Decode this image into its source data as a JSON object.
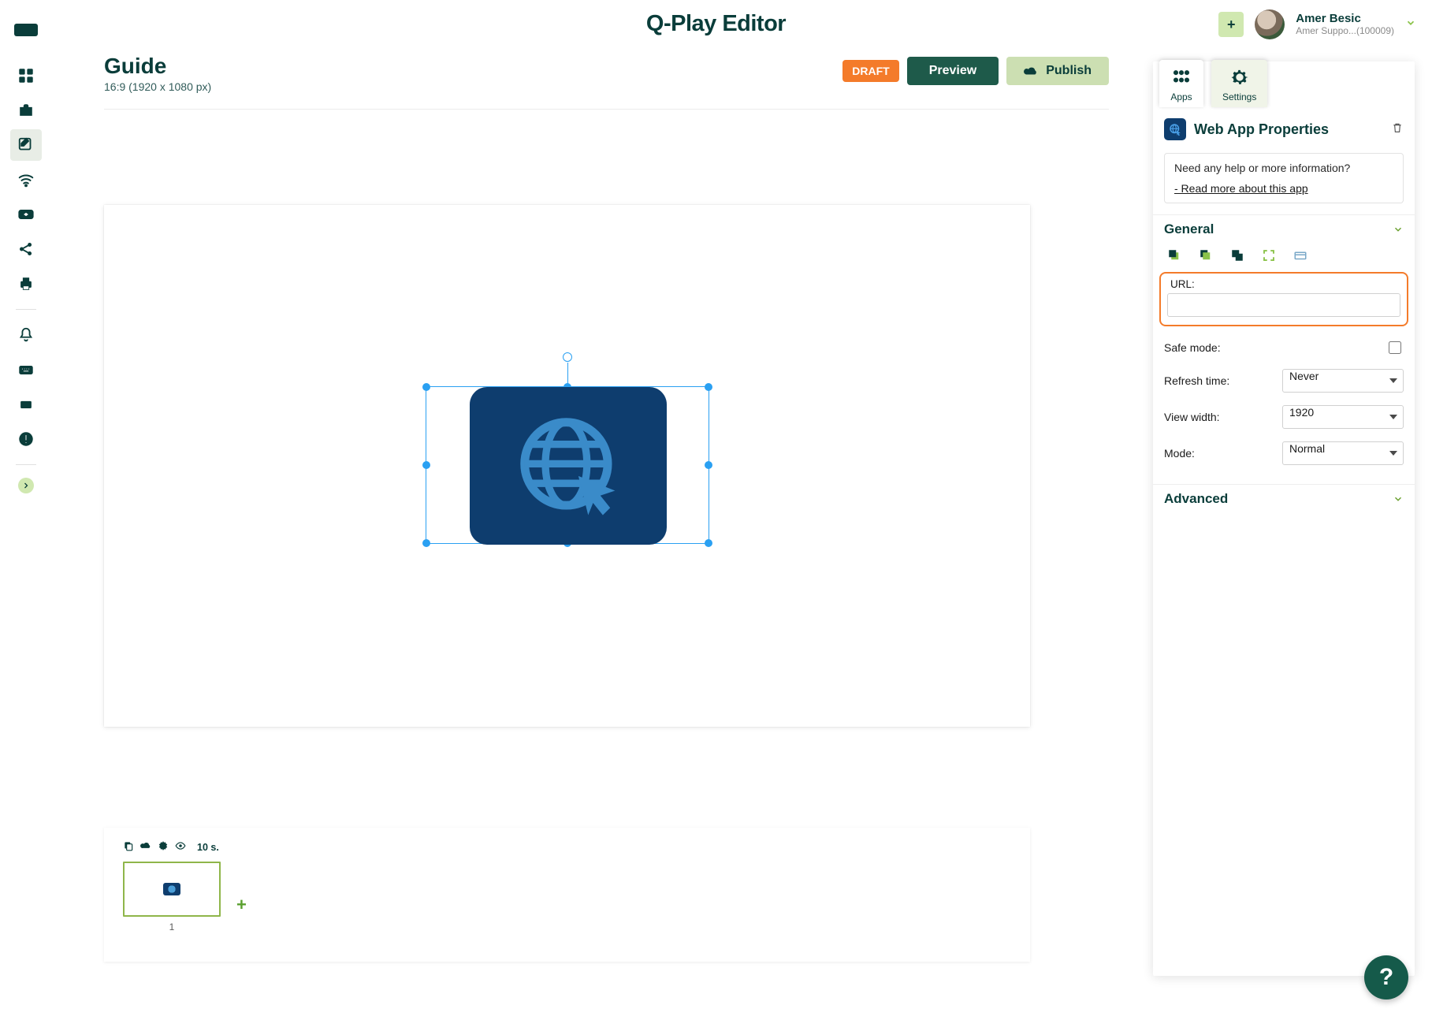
{
  "app": {
    "title": "Q-Play Editor"
  },
  "user": {
    "name": "Amer Besic",
    "org": "Amer Suppo...(100009)"
  },
  "document": {
    "title": "Guide",
    "subtitle": "16:9 (1920 x 1080 px)",
    "status": "DRAFT",
    "preview_label": "Preview",
    "publish_label": "Publish"
  },
  "timeline": {
    "duration_label": "10 s.",
    "slides": [
      {
        "index": "1"
      }
    ],
    "add_label": "+"
  },
  "panel": {
    "tabs": {
      "apps": "Apps",
      "settings": "Settings"
    },
    "title": "Web App Properties",
    "help": {
      "question": "Need any help or more information?",
      "link": "- Read more about this app"
    },
    "sections": {
      "general": "General",
      "advanced": "Advanced"
    },
    "fields": {
      "url_label": "URL:",
      "url_value": "",
      "safe_mode_label": "Safe mode:",
      "safe_mode_checked": false,
      "refresh_label": "Refresh time:",
      "refresh_value": "Never",
      "view_width_label": "View width:",
      "view_width_value": "1920",
      "mode_label": "Mode:",
      "mode_value": "Normal"
    }
  },
  "top_actions": {
    "plus": "+"
  },
  "fab": {
    "label": "?"
  }
}
